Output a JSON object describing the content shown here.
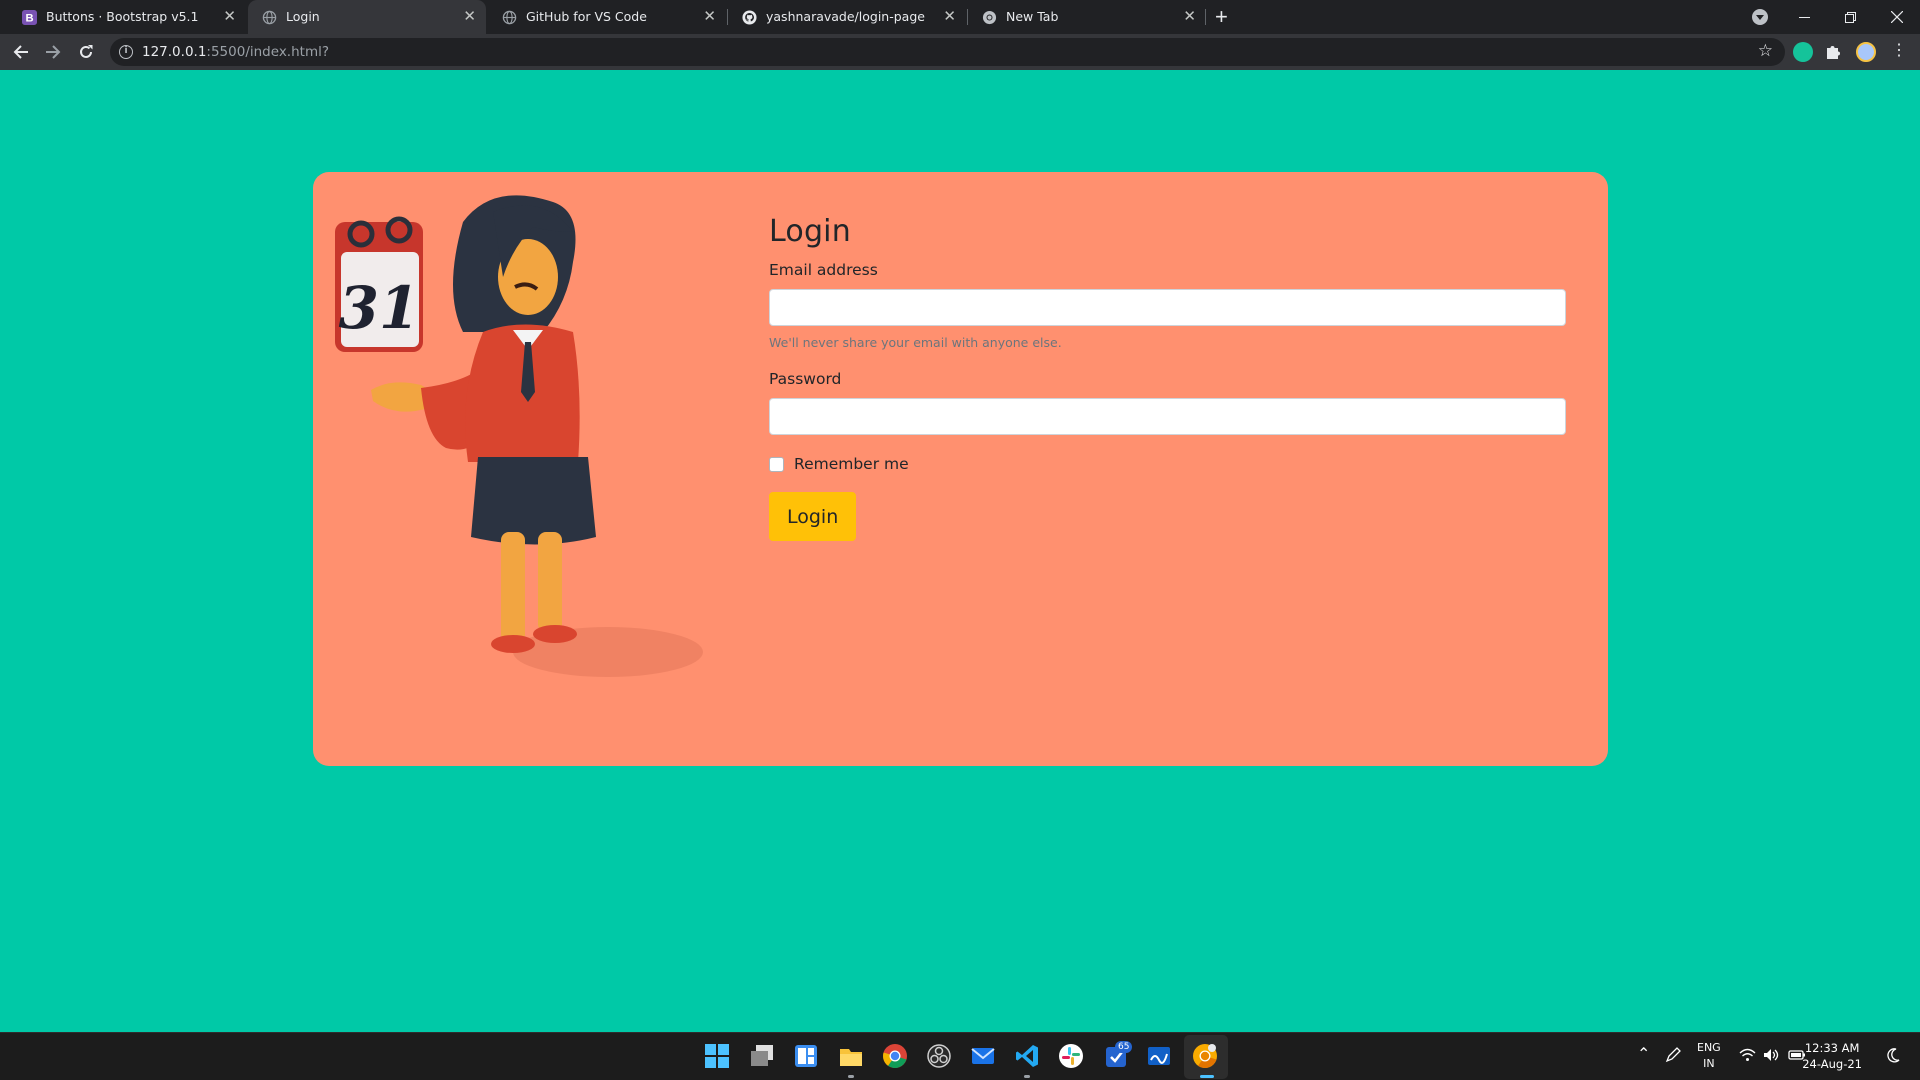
{
  "browser": {
    "tabs": [
      {
        "title": "Buttons · Bootstrap v5.1",
        "icon": "bootstrap-icon",
        "active": false
      },
      {
        "title": "Login",
        "icon": "globe-icon",
        "active": true
      },
      {
        "title": "GitHub for VS Code",
        "icon": "globe-icon",
        "active": false
      },
      {
        "title": "yashnaravade/login-page",
        "icon": "github-icon",
        "active": false
      },
      {
        "title": "New Tab",
        "icon": "chrome-icon",
        "active": false
      }
    ],
    "close_glyph": "✕",
    "new_tab_glyph": "+",
    "address": {
      "host": "127.0.0.1",
      "rest": ":5500/index.html?"
    }
  },
  "page": {
    "title": "Login",
    "email_label": "Email address",
    "email_value": "",
    "email_help": "We'll never share your email with anyone else.",
    "password_label": "Password",
    "password_value": "",
    "remember_label": "Remember me",
    "remember_checked": false,
    "login_button": "Login",
    "illustration_calendar_day": "31"
  },
  "colors": {
    "page_bg": "#00c9a7",
    "card_bg": "#ff906f",
    "button_bg": "#ffc107"
  },
  "taskbar": {
    "icons": [
      "windows-start-icon",
      "task-view-icon",
      "widgets-icon",
      "file-explorer-icon",
      "chrome-icon",
      "obs-icon",
      "mail-icon",
      "vscode-icon",
      "slack-icon",
      "todo-icon",
      "whiteboard-icon",
      "chrome-canary-icon"
    ],
    "badge": "65",
    "lang_top": "ENG",
    "lang_bottom": "IN",
    "time": "12:33 AM",
    "date": "24-Aug-21"
  }
}
